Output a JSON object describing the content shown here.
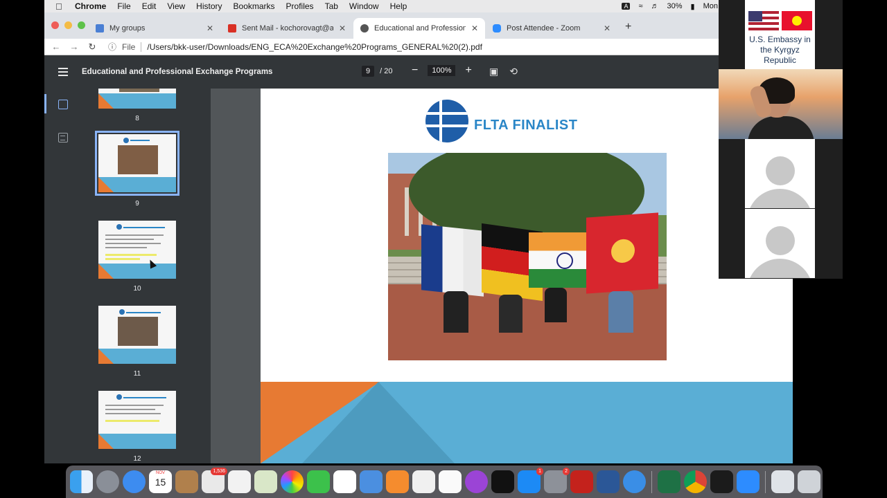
{
  "menubar": {
    "app": "Chrome",
    "items": [
      "File",
      "Edit",
      "View",
      "History",
      "Bookmarks",
      "Profiles",
      "Tab",
      "Window",
      "Help"
    ],
    "input_source": "A",
    "battery": "30%",
    "clock": "Mon"
  },
  "browser": {
    "tabs": [
      {
        "title": "My groups",
        "icon": "groups-icon",
        "color": "#4a7fd4"
      },
      {
        "title": "Sent Mail - kochorovagt@ame",
        "icon": "gmail-icon",
        "color": "#d93025"
      },
      {
        "title": "Educational and Professional E",
        "icon": "globe-icon",
        "color": "#555555"
      },
      {
        "title": "Post Attendee - Zoom",
        "icon": "zoom-icon",
        "color": "#2d8cff"
      }
    ],
    "address": {
      "scheme_label": "File",
      "url": "/Users/bkk-user/Downloads/ENG_ECA%20Exchange%20Programs_GENERAL%20(2).pdf"
    }
  },
  "pdf": {
    "title": "Educational and Professional Exchange Programs",
    "current_page": "9",
    "total_pages": "/ 20",
    "zoom": "100%",
    "thumbnails": [
      {
        "page": "8"
      },
      {
        "page": "9"
      },
      {
        "page": "10"
      },
      {
        "page": "11"
      },
      {
        "page": "12"
      }
    ],
    "slide": {
      "heading": "FLTA FINALIST"
    }
  },
  "zoom_gallery": {
    "embassy_line1": "U.S. Embassy in",
    "embassy_line2": "the Kyrgyz Republic"
  },
  "dock": {
    "calendar_month": "NOV",
    "calendar_day": "15",
    "badges": {
      "mail": "1,536",
      "appstore": "1",
      "settings": "2"
    }
  },
  "colors": {
    "accent_orange": "#e77a33",
    "accent_blue": "#5aaed5",
    "flta_blue": "#2a86c7",
    "viewer_dark": "#323639"
  }
}
